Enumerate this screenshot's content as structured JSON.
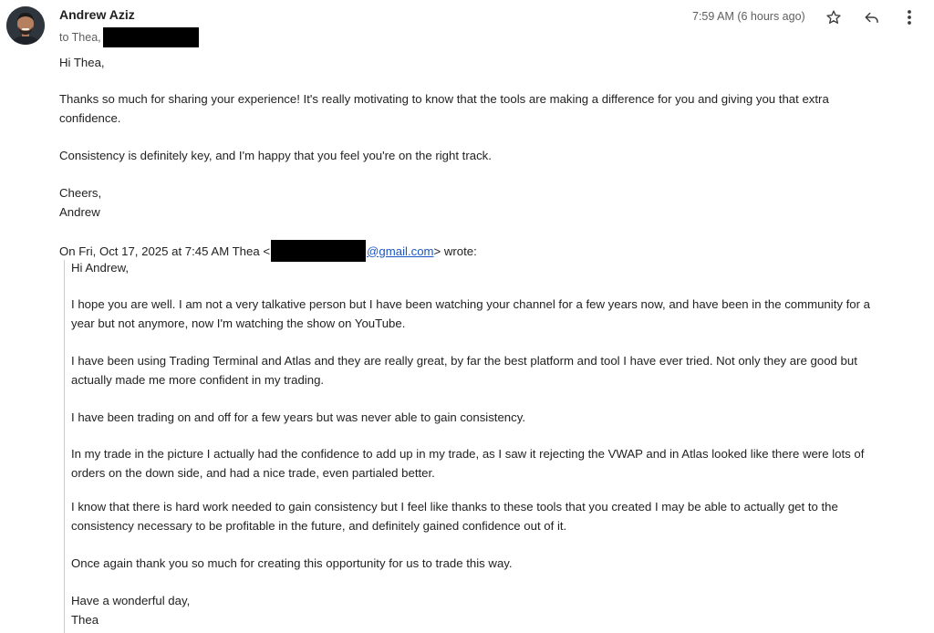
{
  "header": {
    "sender_name": "Andrew Aziz",
    "to_label": "to Thea,",
    "timestamp": "7:59 AM (6 hours ago)",
    "icons": {
      "avatar": "avatar-photo",
      "star": "star-icon",
      "reply": "reply-icon",
      "more": "more-vert-icon"
    }
  },
  "reply": {
    "greeting": "Hi Thea,",
    "p1": "Thanks so much for sharing your experience! It's really motivating to know that the tools are making a difference for you and giving you that extra\nconfidence.",
    "p2": "Consistency is definitely key, and I'm happy that you feel you're on the right track.",
    "signoff": "Cheers,\nAndrew"
  },
  "quoted": {
    "header_prefix": "On Fri, Oct 17, 2025 at 7:45 AM Thea <",
    "email_domain": "@gmail.com",
    "header_suffix": "> wrote:",
    "greeting": "Hi Andrew,",
    "p1": "I hope you are well. I am not a very talkative person but I have been watching your channel for a few years now, and have been in the community for a\nyear but not anymore, now I'm watching the show on YouTube.",
    "p2": "I have been using Trading Terminal and Atlas and they are really great, by far the best platform and tool I have ever tried. Not only they are good but\nactually made me more confident in my trading.",
    "p3": "I have been trading on and off for a few years but was never able to gain consistency.",
    "p4": "In my trade in the picture I actually had the confidence to add up in my trade, as I saw it rejecting the VWAP and in Atlas looked like there were lots of\norders on the down side, and had a nice trade, even partialed better.",
    "p5": "I know that there is hard work needed to gain consistency but I feel like thanks to these tools that you created I may be able to actually get to the\nconsistency necessary to be profitable in the future, and definitely gained  confidence out of it.",
    "p6": "Once again thank you so much for creating this opportunity for us to trade this way.",
    "signoff": "Have a wonderful day,\nThea"
  },
  "colors": {
    "link": "#1a56c4",
    "redaction": "#000000",
    "meta_text": "#5e5e5e",
    "quote_bar": "#cccccc"
  }
}
